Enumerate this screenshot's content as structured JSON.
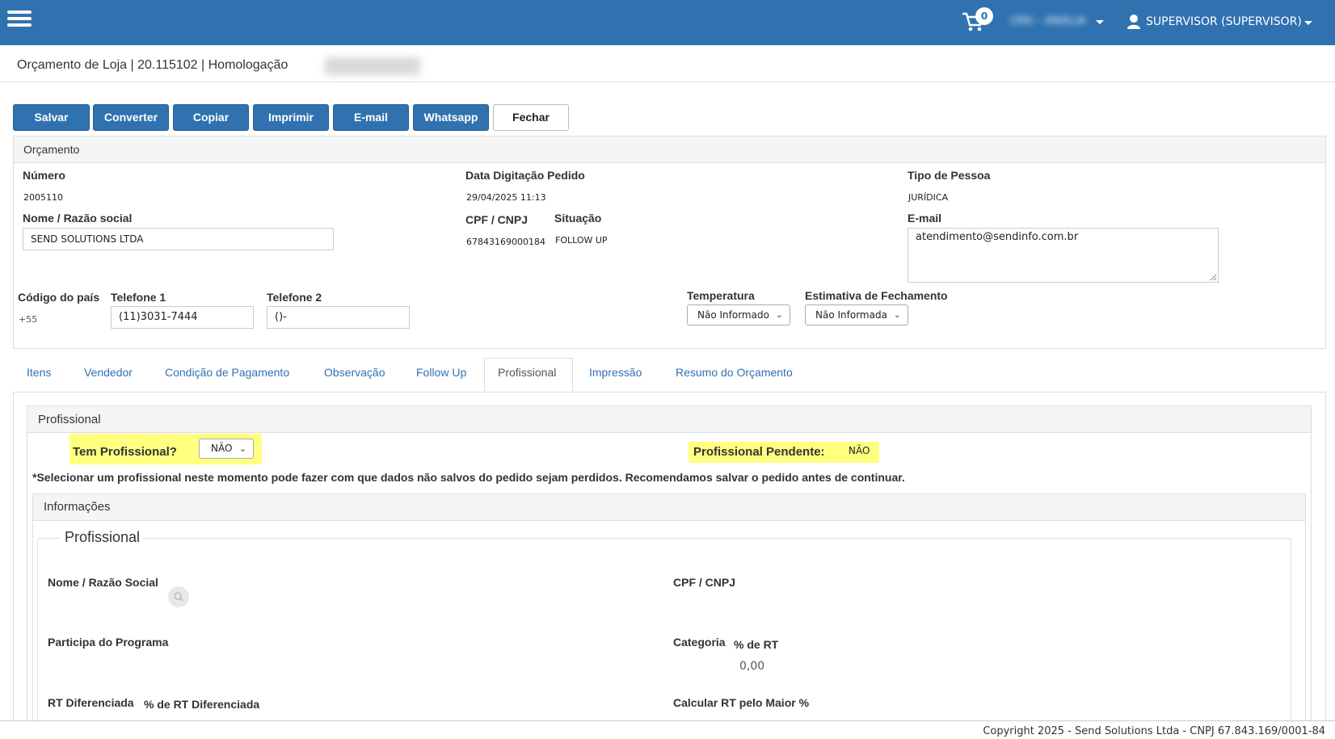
{
  "header": {
    "cart_count": "0",
    "store_selector": "(99) - ANALIA",
    "user": "SUPERVISOR (SUPERVISOR)"
  },
  "page": {
    "title": "Orçamento de Loja | 20.115102 | Homologação"
  },
  "toolbar": {
    "save": "Salvar",
    "convert": "Converter",
    "copy": "Copiar",
    "print": "Imprimir",
    "email": "E-mail",
    "whatsapp": "Whatsapp",
    "close": "Fechar"
  },
  "orcamento": {
    "panel_title": "Orçamento",
    "numero_label": "Número",
    "numero": "2005110",
    "data_label": "Data Digitação Pedido",
    "data": "29/04/2025 11:13",
    "tipo_pessoa_label": "Tipo de Pessoa",
    "tipo_pessoa": "JURÍDICA",
    "nome_label": "Nome / Razão social",
    "nome": "SEND SOLUTIONS LTDA",
    "cpf_label": "CPF / CNPJ",
    "cpf": "67843169000184",
    "situacao_label": "Situação",
    "situacao": "FOLLOW UP",
    "email_label": "E-mail",
    "email": "atendimento@sendinfo.com.br",
    "codigo_pais_label": "Código do país",
    "codigo_pais": "+55",
    "telefone1_label": "Telefone 1",
    "telefone1": "(11)3031-7444",
    "telefone2_label": "Telefone 2",
    "telefone2": "()-",
    "temperatura_label": "Temperatura",
    "temperatura": "Não Informado",
    "estimativa_label": "Estimativa de Fechamento",
    "estimativa": "Não Informada"
  },
  "tabs": [
    {
      "label": "Itens"
    },
    {
      "label": "Vendedor"
    },
    {
      "label": "Condição de Pagamento"
    },
    {
      "label": "Observação"
    },
    {
      "label": "Follow Up"
    },
    {
      "label": "Profissional"
    },
    {
      "label": "Impressão"
    },
    {
      "label": "Resumo do Orçamento"
    }
  ],
  "profissional": {
    "panel_title": "Profissional",
    "tem_profissional_label": "Tem Profissional?",
    "tem_profissional": "NÃO",
    "pendente_label": "Profissional Pendente:",
    "pendente": "NÃO",
    "warning": "*Selecionar um profissional neste momento pode fazer com que dados não salvos do pedido sejam perdidos. Recomendamos salvar o pedido antes de continuar.",
    "info_title": "Informações",
    "fieldset_legend": "Profissional",
    "nome_label": "Nome / Razão Social",
    "cpf_label": "CPF / CNPJ",
    "participa_label": "Participa do Programa",
    "categoria_label": "Categoria",
    "pct_rt_label": "% de RT",
    "pct_rt": "0,00",
    "rt_dif_label": "RT Diferenciada",
    "pct_rt_dif_label": "% de RT Diferenciada",
    "calc_rt_label": "Calcular RT pelo Maior %"
  },
  "footer": {
    "copyright": "Copyright 2025 - Send Solutions Ltda - CNPJ 67.843.169/0001-84"
  }
}
